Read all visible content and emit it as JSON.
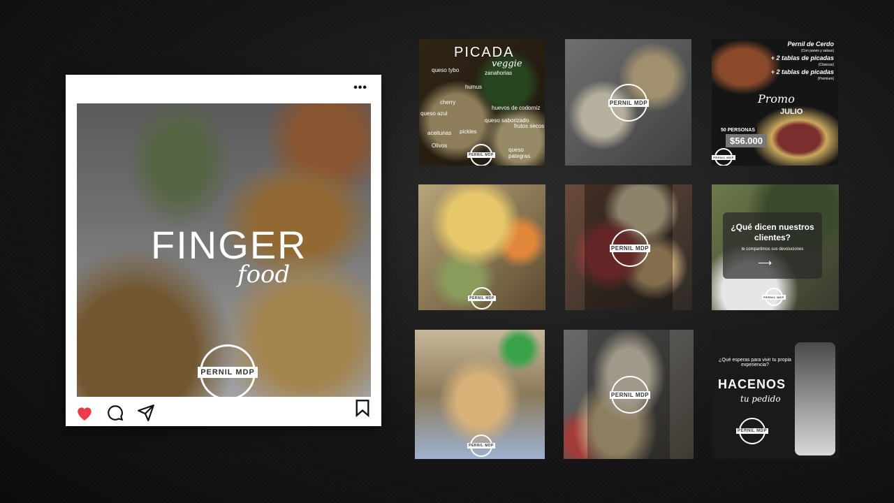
{
  "post": {
    "more_icon": "ellipsis-icon",
    "title": "FINGER",
    "subtitle": "food",
    "logo_text": "PERNIL MDP",
    "actions": [
      "heart-icon",
      "comment-icon",
      "share-icon"
    ],
    "bookmark_icon": "bookmark-icon",
    "heart_color": "#ee3b4a"
  },
  "tiles": [
    {
      "title": "PICADA",
      "subtitle": "veggie",
      "labels": [
        "queso tybo",
        "zanahorias",
        "humus",
        "cherry",
        "queso azul",
        "huevos de codorniz",
        "queso saborizado",
        "frutos secos",
        "pickles",
        "aceitunas",
        "Olivos",
        "queso pategras"
      ],
      "logo_text": "PERNIL MDP"
    },
    {
      "logo_text": "PERNIL MDP"
    },
    {
      "line1": "Pernil de Cerdo",
      "line1_small": "(Con panes y salsas)",
      "line2": "+ 2 tablas de picadas",
      "line2_small": "(Clásicas)",
      "line3": "+ 2 tablas de picadas",
      "line3_small": "(Premium)",
      "promo": "Promo",
      "month": "JULIO",
      "people": "50 PERSONAS",
      "price": "$56.000",
      "logo_text": "PERNIL MDP"
    },
    {
      "logo_text": "PERNIL MDP"
    },
    {
      "logo_text": "PERNIL MDP"
    },
    {
      "heading": "¿Qué dicen nuestros clientes?",
      "sub": "te compartimos sus devoluciones",
      "logo_text": "PERNIL MDP"
    },
    {
      "logo_text": "PERNIL MDP"
    },
    {
      "logo_text": "PERNIL MDP"
    },
    {
      "question": "¿Qué esperas para vivir tu propia experiencia?",
      "cta": "HACENOS",
      "cta_sub": "tu pedido",
      "logo_text": "PERNIL MDP"
    }
  ]
}
